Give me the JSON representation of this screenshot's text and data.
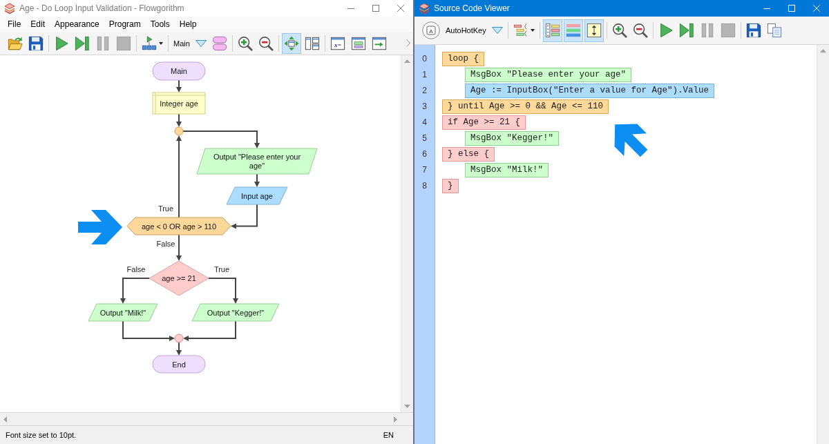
{
  "flowchart_window": {
    "title": "Age - Do Loop Input Validation - Flowgorithm",
    "active": false,
    "menu": [
      "File",
      "Edit",
      "Appearance",
      "Program",
      "Tools",
      "Help"
    ],
    "toolbar": [
      [
        {
          "kind": "open",
          "on": false,
          "disabled": false
        },
        {
          "kind": "save",
          "on": false,
          "disabled": false
        }
      ],
      [
        {
          "kind": "run",
          "on": false,
          "disabled": false
        },
        {
          "kind": "step",
          "on": false,
          "disabled": false
        },
        {
          "kind": "pause",
          "on": false,
          "disabled": true
        },
        {
          "kind": "stop",
          "on": false,
          "disabled": true
        }
      ],
      [
        {
          "kind": "layout_menu",
          "on": false,
          "disabled": false
        }
      ],
      [
        {
          "kind": "function_select",
          "label": "Main",
          "on": false,
          "disabled": false
        },
        {
          "kind": "functions",
          "on": false,
          "disabled": false
        }
      ],
      [
        {
          "kind": "zoom_in",
          "on": false,
          "disabled": false
        },
        {
          "kind": "zoom_out",
          "on": false,
          "disabled": false
        }
      ],
      [
        {
          "kind": "move",
          "on": true,
          "disabled": false
        },
        {
          "kind": "panels",
          "on": false,
          "disabled": false
        }
      ],
      [
        {
          "kind": "variables",
          "glyph": "x=",
          "on": false,
          "disabled": false
        },
        {
          "kind": "console",
          "on": false,
          "disabled": false
        },
        {
          "kind": "arrow_window",
          "on": false,
          "disabled": false
        }
      ]
    ],
    "flowchart": {
      "nodes": [
        {
          "kind": "terminal",
          "text": "Main"
        },
        {
          "kind": "declare",
          "text": "Integer age"
        },
        {
          "kind": "loop_point"
        },
        {
          "kind": "output",
          "text": "Output \"Please enter your age\""
        },
        {
          "kind": "input",
          "text": "Input age"
        },
        {
          "kind": "loop_condition",
          "text": "age < 0 OR age > 110"
        },
        {
          "kind": "if_condition",
          "text": "age >= 21"
        },
        {
          "kind": "output",
          "text": "Output \"Milk!\""
        },
        {
          "kind": "output",
          "text": "Output \"Kegger!\""
        },
        {
          "kind": "merge_point"
        },
        {
          "kind": "terminal",
          "text": "End"
        }
      ],
      "branch_labels": [
        "True",
        "False",
        "False",
        "True"
      ]
    },
    "status_bar": {
      "message": "Font size set to 10pt.",
      "language": "EN"
    }
  },
  "code_window": {
    "title": "Source Code Viewer",
    "active": true,
    "toolbar": [
      [
        {
          "kind": "language",
          "glyph": "A",
          "on": false,
          "disabled": false
        },
        {
          "kind": "language_select",
          "label": "AutoHotKey",
          "on": false,
          "disabled": false
        }
      ],
      [
        {
          "kind": "format_menu",
          "on": false,
          "disabled": false
        }
      ],
      [
        {
          "kind": "line_numbers",
          "on": true,
          "disabled": false
        },
        {
          "kind": "colors",
          "on": true,
          "disabled": false
        },
        {
          "kind": "expand",
          "on": true,
          "disabled": false
        }
      ],
      [
        {
          "kind": "zoom_in",
          "on": false,
          "disabled": false
        },
        {
          "kind": "zoom_out",
          "on": false,
          "disabled": false
        }
      ],
      [
        {
          "kind": "run",
          "on": false,
          "disabled": false
        },
        {
          "kind": "step",
          "on": false,
          "disabled": false
        },
        {
          "kind": "pause",
          "on": false,
          "disabled": true
        },
        {
          "kind": "stop",
          "on": false,
          "disabled": true
        }
      ],
      [
        {
          "kind": "save",
          "on": false,
          "disabled": false
        },
        {
          "kind": "copy",
          "on": false,
          "disabled": false
        }
      ]
    ],
    "line_numbers": [
      "0",
      "1",
      "2",
      "3",
      "4",
      "5",
      "6",
      "7",
      "8"
    ],
    "code": [
      {
        "kind": "loop",
        "text": "loop {",
        "children": [
          {
            "kind": "output",
            "text": "MsgBox \"Please enter your age\""
          },
          {
            "kind": "input",
            "text": "Age := InputBox(\"Enter a value for Age\").Value"
          }
        ]
      },
      {
        "kind": "loop",
        "text": "} until Age >= 0 && Age <= 110"
      },
      {
        "kind": "if",
        "text": "if Age >= 21 {",
        "children": [
          {
            "kind": "output",
            "text": "MsgBox \"Kegger!\""
          }
        ]
      },
      {
        "kind": "if",
        "text": "} else {",
        "children": [
          {
            "kind": "output",
            "text": "MsgBox \"Milk!\""
          }
        ]
      },
      {
        "kind": "if",
        "text": "}"
      }
    ]
  }
}
